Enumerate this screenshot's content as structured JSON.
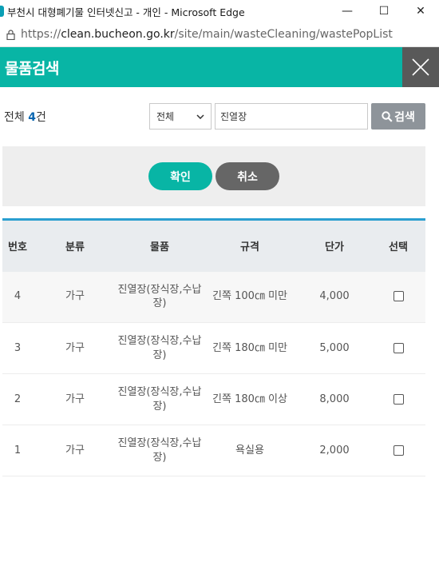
{
  "window": {
    "title": "부천시 대형폐기물 인터넷신고 - 개인 - Microsoft Edge",
    "minimize": "—",
    "maximize": "☐",
    "close": "✕"
  },
  "address": {
    "scheme": "https://",
    "host": "clean.bucheon.go.kr",
    "path": "/site/main/wasteCleaning/wastePopList"
  },
  "popup": {
    "title": "물품검색"
  },
  "search": {
    "total_prefix": "전체 ",
    "total_count": "4",
    "total_suffix": "건",
    "category_selected": "전체",
    "query_value": "진열장",
    "button_label": "검색"
  },
  "actions": {
    "confirm_label": "확인",
    "cancel_label": "취소"
  },
  "table": {
    "headers": [
      "번호",
      "분류",
      "물품",
      "규격",
      "단가",
      "선택"
    ],
    "rows": [
      {
        "no": "4",
        "category": "가구",
        "item": "진열장(장식장,수납장)",
        "spec": "긴쪽 100㎝ 미만",
        "price": "4,000"
      },
      {
        "no": "3",
        "category": "가구",
        "item": "진열장(장식장,수납장)",
        "spec": "긴쪽 180㎝ 미만",
        "price": "5,000"
      },
      {
        "no": "2",
        "category": "가구",
        "item": "진열장(장식장,수납장)",
        "spec": "긴쪽 180㎝ 이상",
        "price": "8,000"
      },
      {
        "no": "1",
        "category": "가구",
        "item": "진열장(장식장,수납장)",
        "spec": "욕실용",
        "price": "2,000"
      }
    ]
  }
}
